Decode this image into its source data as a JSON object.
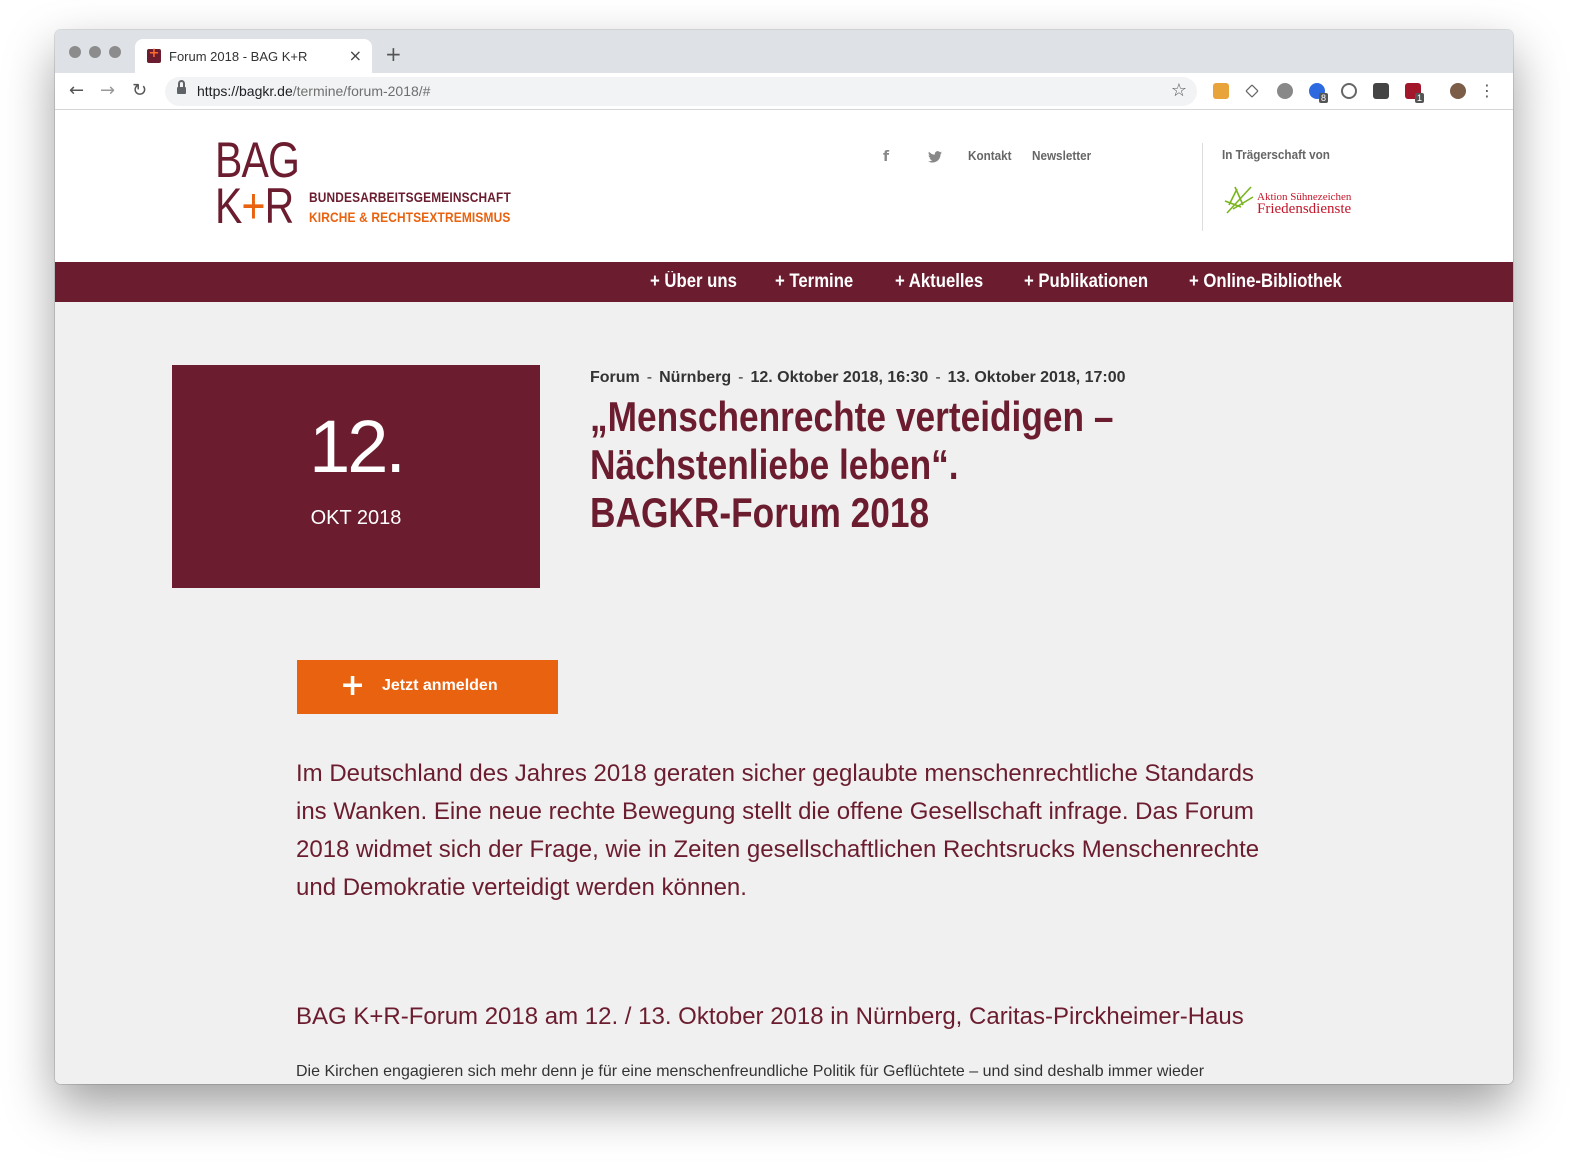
{
  "browser": {
    "tab_title": "Forum 2018 - BAG K+R",
    "tab_close": "×",
    "new_tab": "+",
    "url_host": "https://bagkr.de",
    "url_path": "/termine/forum-2018/#",
    "back": "←",
    "forward": "→",
    "reload": "↻",
    "star": "☆",
    "menu": "⋮",
    "extension_badges": [
      "8",
      "1"
    ]
  },
  "header": {
    "logo_line_a": "BAG",
    "logo_line_b_k": "K",
    "logo_line_b_plus": "+",
    "logo_line_b_r": "R",
    "org_line1": "BUNDESARBEITSGEMEINSCHAFT",
    "org_line2": "KIRCHE & RECHTSEXTREMISMUS",
    "facebook": "f",
    "twitter": "🐦",
    "kontakt": "Kontakt",
    "newsletter": "Newsletter",
    "sponsor_label": "In Trägerschaft von",
    "sponsor_line1": "Aktion Sühnezeichen",
    "sponsor_line2": "Friedensdienste"
  },
  "nav": {
    "items": [
      {
        "label": "+ Über uns"
      },
      {
        "label": "+ Termine"
      },
      {
        "label": "+ Aktuelles"
      },
      {
        "label": "+ Publikationen"
      },
      {
        "label": "+ Online-Bibliothek"
      }
    ]
  },
  "event": {
    "day": "12.",
    "month": "OKT 2018",
    "category": "Forum",
    "city": "Nürnberg",
    "start": "12. Oktober 2018, 16:30",
    "end": "13. Oktober 2018, 17:00",
    "separator": "-",
    "title_line1": "„Menschenrechte verteidigen –",
    "title_line2": "Nächstenliebe leben“.",
    "title_line3": "BAGKR-Forum 2018",
    "register_icon": "+",
    "register_label": "Jetzt anmelden",
    "intro": "Im Deutschland des Jahres 2018 geraten sicher geglaubte menschenrechtliche Standards ins Wanken. Eine neue rechte Bewegung stellt die offene Gesellschaft infrage. Das Forum 2018 widmet sich der Frage, wie in Zeiten gesellschaftlichen Rechtsrucks Menschenrechte und Demokratie verteidigt werden können.",
    "subheading": "BAG K+R-Forum 2018 am 12. / 13. Oktober 2018 in Nürnberg, Caritas-Pirckheimer-Haus",
    "body": "Die Kirchen engagieren sich mehr denn je für eine menschenfreundliche Politik für Geflüchtete – und sind deshalb immer wieder"
  },
  "colors": {
    "brand": "#6b1d2f",
    "accent": "#e8620f",
    "page_bg": "#f0f0f0"
  }
}
